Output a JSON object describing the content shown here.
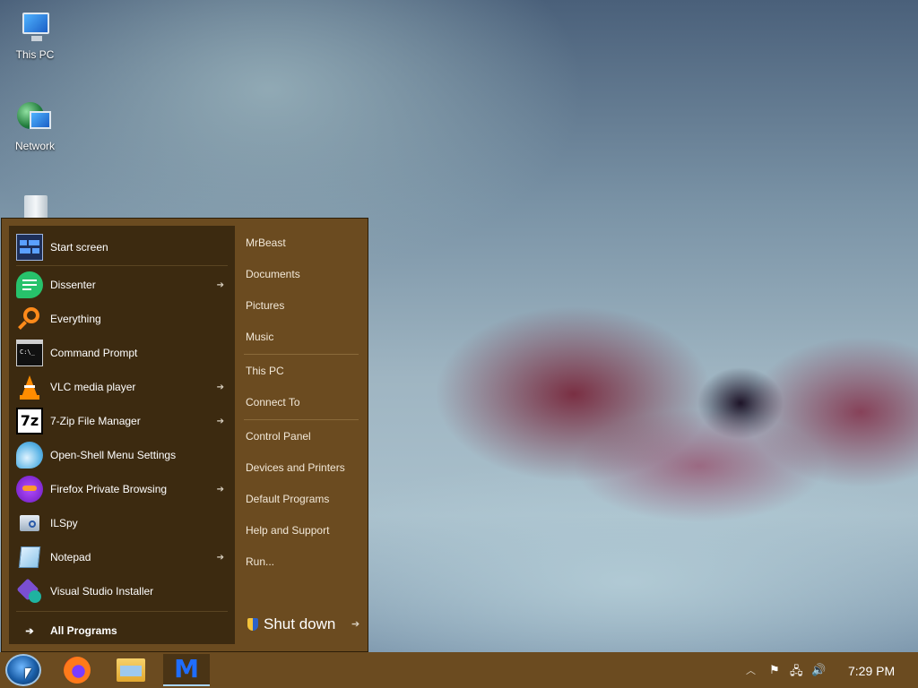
{
  "desktop": {
    "icons": [
      {
        "label": "This PC",
        "icon": "computer-icon"
      },
      {
        "label": "Network",
        "icon": "network-icon"
      },
      {
        "label": "",
        "icon": "recycle-bin-icon"
      }
    ]
  },
  "start_menu": {
    "pinned": [
      {
        "label": "Start screen",
        "icon": "start-screen-icon",
        "has_submenu": false
      },
      {
        "label": "Dissenter",
        "icon": "dissenter-icon",
        "has_submenu": true
      },
      {
        "label": "Everything",
        "icon": "everything-search-icon",
        "has_submenu": false
      },
      {
        "label": "Command Prompt",
        "icon": "command-prompt-icon",
        "has_submenu": false
      },
      {
        "label": "VLC media player",
        "icon": "vlc-cone-icon",
        "has_submenu": true
      },
      {
        "label": "7-Zip File Manager",
        "icon": "7zip-icon",
        "has_submenu": true
      },
      {
        "label": "Open-Shell Menu Settings",
        "icon": "open-shell-icon",
        "has_submenu": false
      },
      {
        "label": "Firefox Private Browsing",
        "icon": "firefox-private-icon",
        "has_submenu": true
      },
      {
        "label": "ILSpy",
        "icon": "ilspy-icon",
        "has_submenu": false
      },
      {
        "label": "Notepad",
        "icon": "notepad-icon",
        "has_submenu": true
      },
      {
        "label": "Visual Studio Installer",
        "icon": "vs-installer-icon",
        "has_submenu": false
      }
    ],
    "all_programs": "All Programs",
    "right_items": [
      "MrBeast",
      "Documents",
      "Pictures",
      "Music",
      "This PC",
      "Connect To",
      "Control Panel",
      "Devices and Printers",
      "Default Programs",
      "Help and Support",
      "Run..."
    ],
    "shutdown": "Shut down"
  },
  "taskbar": {
    "apps": [
      {
        "name": "Firefox",
        "icon": "firefox-icon"
      },
      {
        "name": "File Explorer",
        "icon": "file-explorer-icon"
      },
      {
        "name": "Malwarebytes",
        "icon": "malwarebytes-icon",
        "glyph": "M"
      }
    ],
    "tray_icons": [
      "chevron-up-icon",
      "flag-icon",
      "network-icon",
      "volume-icon"
    ],
    "clock": "7:29 PM"
  },
  "colors": {
    "menu_bg": "#6b4b20",
    "menu_left_bg": "#3c2a10",
    "taskbar_bg": "#6b4b20"
  }
}
